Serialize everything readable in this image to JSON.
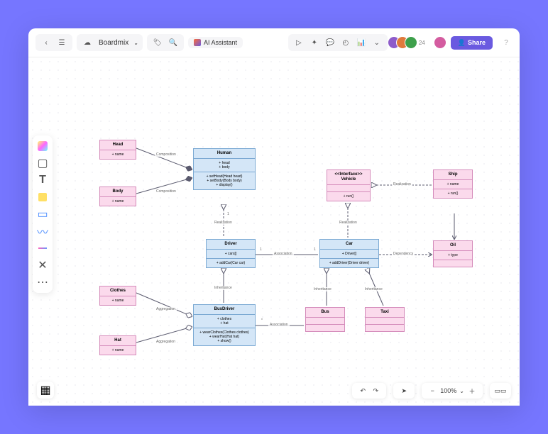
{
  "header": {
    "doc_name": "Boardmix",
    "ai_label": "AI Assistant",
    "user_count": "24",
    "share_label": "Share"
  },
  "palette": [
    "ai",
    "frame",
    "text",
    "note",
    "shape",
    "line",
    "pen",
    "eraser",
    "more"
  ],
  "zoom": {
    "value": "100%"
  },
  "uml": {
    "head": {
      "title": "Head",
      "attrs": "+ name"
    },
    "body": {
      "title": "Body",
      "attrs": "+ name"
    },
    "human": {
      "title": "Human",
      "attrs": "+ head\n+ body",
      "ops": "+ setHead(Head head)\n+ setBody(Body body)\n+ display()"
    },
    "vehicle": {
      "title": "<<Interface>>\nVehicle",
      "attrs": "",
      "ops": "+ run()"
    },
    "ship": {
      "title": "Ship",
      "attrs": "+ name",
      "ops": "+ run()"
    },
    "driver": {
      "title": "Driver",
      "attrs": "+ cars[]",
      "ops": "+ addCar(Car car)"
    },
    "car": {
      "title": "Car",
      "attrs": "+ Driver[]",
      "ops": "+ addDriver(Driver driver)"
    },
    "oil": {
      "title": "Oil",
      "attrs": "+ type"
    },
    "clothes": {
      "title": "Clothes",
      "attrs": "+ name"
    },
    "hat": {
      "title": "Hat",
      "attrs": "+ name"
    },
    "busdriver": {
      "title": "BusDriver",
      "attrs": "+ clothes\n+ hat",
      "ops": "+ wearClothes(Clothes clothes)\n+ wearHat(Hat hat)\n+ show()"
    },
    "bus": {
      "title": "Bus"
    },
    "taxi": {
      "title": "Taxi"
    }
  },
  "labels": {
    "composition1": "Composition",
    "composition2": "Composition",
    "realization1": "Realization",
    "realization2": "Realization",
    "realization3": "Realization",
    "association1": "Association",
    "association2": "Association",
    "dependency": "Dependency",
    "inheritance1": "Inheritance",
    "inheritance2": "Inheritance",
    "inheritance3": "Inheritance",
    "aggregation1": "Aggregation",
    "aggregation2": "Aggregation"
  },
  "multiplicities": {
    "one_a": "1",
    "one_b": "1",
    "star": "*"
  }
}
